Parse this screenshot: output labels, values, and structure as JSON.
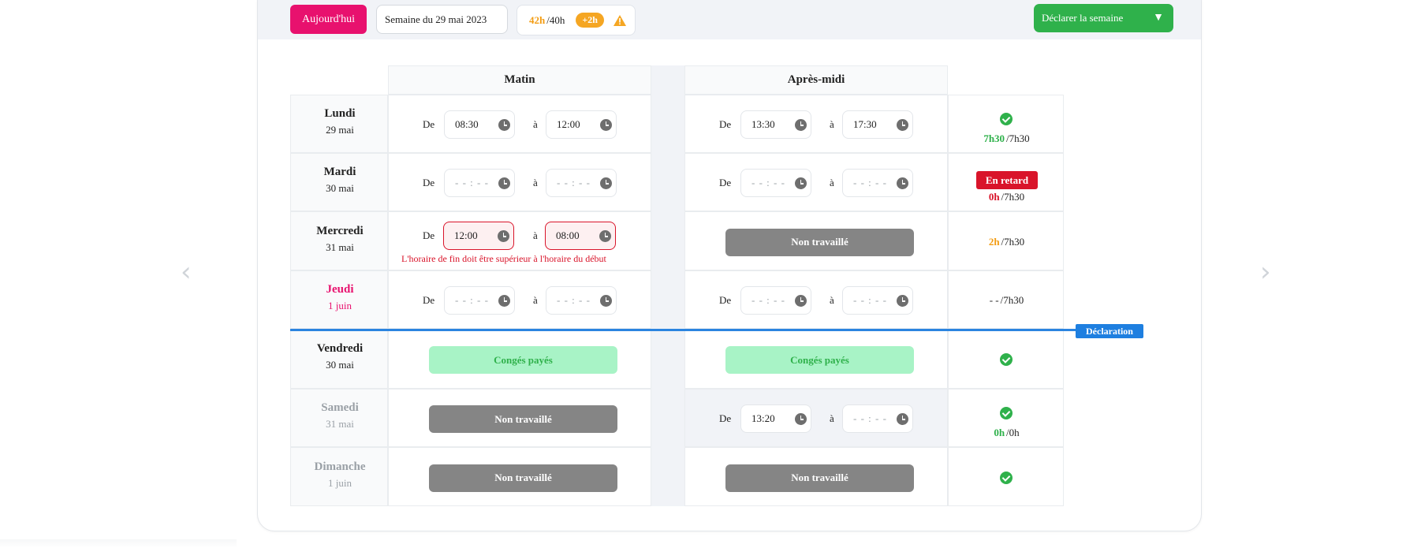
{
  "toolbar": {
    "today_label": "Aujourd'hui",
    "week_label": "Semaine du 29 mai 2023",
    "hours_done": "42h",
    "hours_target": "/40h",
    "hours_diff": "+2h",
    "declare_label": "Déclarer la semaine",
    "declare_caret": "▼"
  },
  "nav": {
    "prev": "‹",
    "next": "›"
  },
  "columns": {
    "morning": "Matin",
    "afternoon": "Après-midi"
  },
  "labels": {
    "from": "De",
    "to": "à"
  },
  "days": [
    {
      "name": "Lundi",
      "date": "29 mai",
      "morning": {
        "from": "08:30",
        "to": "12:00"
      },
      "afternoon": {
        "from": "13:30",
        "to": "17:30"
      },
      "status": {
        "check": true,
        "done": "7h30",
        "target": "/7h30"
      }
    },
    {
      "name": "Mardi",
      "date": "30 mai",
      "morning": {
        "from": "- - : - -",
        "to": "- - : - -"
      },
      "afternoon": {
        "from": "- - : - -",
        "to": "- - : - -"
      },
      "status": {
        "badge": "En retard",
        "done": "0h",
        "target": "/7h30"
      }
    },
    {
      "name": "Mercredi",
      "date": "31 mai",
      "morning": {
        "from": "12:00",
        "to": "08:00",
        "error": "L'horaire de fin doit être supérieur à l'horaire du début"
      },
      "afternoon": {
        "pill": "Non travaillé"
      },
      "status": {
        "done": "2h",
        "target": "/7h30"
      }
    },
    {
      "name": "Jeudi",
      "date": "1 juin",
      "morning": {
        "from": "- - : - -",
        "to": "- - : - -"
      },
      "afternoon": {
        "from": "- - : - -",
        "to": "- - : - -"
      },
      "status": {
        "done": "- -",
        "target": "/7h30"
      }
    },
    {
      "name": "Vendredi",
      "date": "30 mai",
      "morning": {
        "pill": "Congés payés"
      },
      "afternoon": {
        "pill": "Congés payés"
      },
      "status": {
        "check": true
      }
    },
    {
      "name": "Samedi",
      "date": "31 mai",
      "morning": {
        "pill": "Non travaillé"
      },
      "afternoon": {
        "from": "13:20",
        "to": "- - : - -"
      },
      "status": {
        "check": true,
        "done": "0h",
        "target": "/0h"
      }
    },
    {
      "name": "Dimanche",
      "date": "1 juin",
      "morning": {
        "pill": "Non travaillé"
      },
      "afternoon": {
        "pill": "Non travaillé"
      },
      "status": {
        "check": true
      }
    }
  ],
  "declaration_marker": "Déclaration",
  "colors": {
    "accent": "#e8116e",
    "success": "#2fb14b",
    "error": "#d9142a",
    "warning": "#f5a623",
    "info": "#1e7fe0"
  }
}
